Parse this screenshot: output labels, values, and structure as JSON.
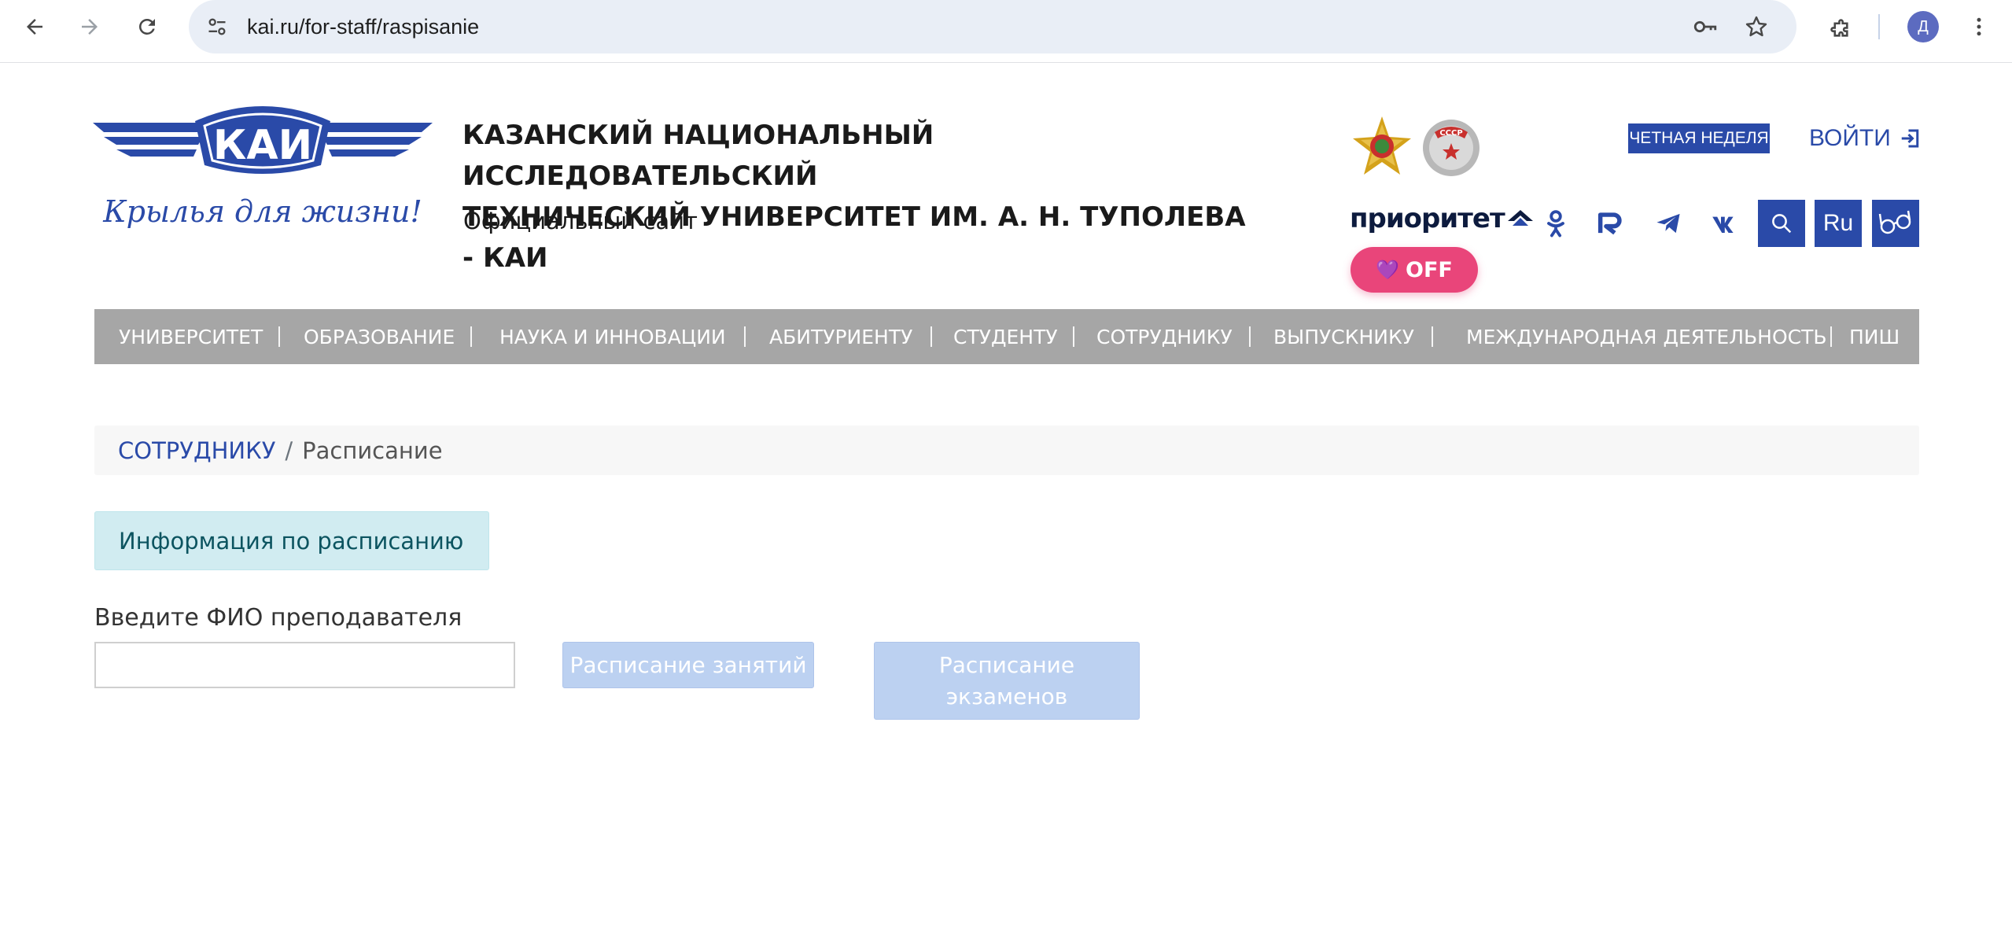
{
  "browser": {
    "url": "kai.ru/for-staff/raspisanie",
    "profile_initial": "Д",
    "icons": [
      "back-icon",
      "forward-icon",
      "reload-icon",
      "site-settings-icon",
      "key-icon",
      "star-icon",
      "extensions-icon",
      "more-icon"
    ]
  },
  "header": {
    "logo_text": "КАИ",
    "logo_slogan": "Крылья для жизни!",
    "title_line1": "КАЗАНСКИЙ НАЦИОНАЛЬНЫЙ ИССЛЕДОВАТЕЛЬСКИЙ",
    "title_line2": "ТЕХНИЧЕСКИЙ УНИВЕРСИТЕТ ИМ. А. Н. ТУПОЛЕВА - КАИ",
    "subtitle": "Официальный сайт",
    "medal2_text": "СССР",
    "week_badge": "ЧЕТНАЯ НЕДЕЛЯ",
    "login_label": "ВОЙТИ",
    "priority_label": "приоритет",
    "lang_label": "Ru",
    "off_label": "OFF",
    "brand_color": "#2a4aa8"
  },
  "menu": {
    "items": [
      "УНИВЕРСИТЕТ",
      "ОБРАЗОВАНИЕ",
      "НАУКА И ИННОВАЦИИ",
      "АБИТУРИЕНТУ",
      "СТУДЕНТУ",
      "СОТРУДНИКУ",
      "ВЫПУСКНИКУ",
      "МЕЖДУНАРОДНАЯ ДЕЯТЕЛЬНОСТЬ",
      "ПИШ"
    ]
  },
  "breadcrumb": {
    "parent": "СОТРУДНИКУ",
    "separator": "/",
    "current": "Расписание"
  },
  "content": {
    "info_box": "Информация по расписанию",
    "fio_label": "Введите ФИО преподавателя",
    "fio_value": "",
    "btn_classes": "Расписание занятий",
    "btn_exams_line1": "Расписание",
    "btn_exams_line2": "экзаменов"
  }
}
